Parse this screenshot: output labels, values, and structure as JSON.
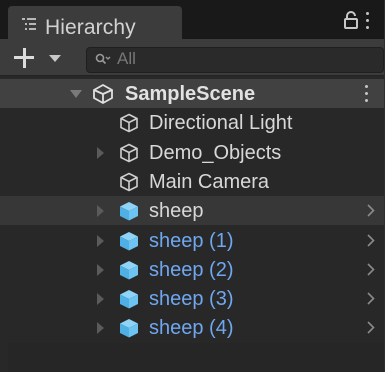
{
  "window": {
    "tab_title": "Hierarchy"
  },
  "toolbar": {
    "search_placeholder": "All"
  },
  "colors": {
    "panel_bg": "#282828",
    "prefab_blue": "#6fa7f0",
    "cube_blue": "#6dc3f2"
  },
  "tree": {
    "scene": {
      "label": "SampleScene",
      "icon": "unity-logo-icon"
    },
    "items": [
      {
        "label": "Directional Light",
        "icon": "gameobject-cube-icon"
      },
      {
        "label": "Demo_Objects",
        "icon": "gameobject-cube-icon"
      },
      {
        "label": "Main Camera",
        "icon": "gameobject-cube-icon"
      },
      {
        "label": "sheep",
        "icon": "prefab-cube-icon"
      },
      {
        "label": "sheep (1)",
        "icon": "prefab-cube-icon"
      },
      {
        "label": "sheep (2)",
        "icon": "prefab-cube-icon"
      },
      {
        "label": "sheep (3)",
        "icon": "prefab-cube-icon"
      },
      {
        "label": "sheep (4)",
        "icon": "prefab-cube-icon"
      }
    ]
  }
}
